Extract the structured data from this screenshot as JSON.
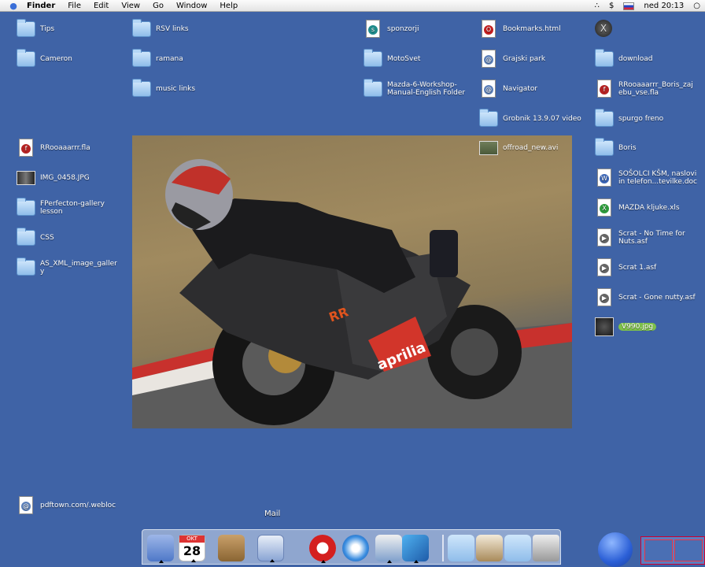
{
  "menubar": {
    "apple": "",
    "app_name": "Finder",
    "items": [
      "File",
      "Edit",
      "View",
      "Go",
      "Window",
      "Help"
    ],
    "clock": "ned 20:13"
  },
  "desktop_icons": [
    {
      "label": "Tips",
      "type": "folder"
    },
    {
      "label": "Cameron",
      "type": "folder"
    },
    {
      "label": "RSV links",
      "type": "folder"
    },
    {
      "label": "ramana",
      "type": "folder"
    },
    {
      "label": "music links",
      "type": "folder"
    },
    {
      "label": "sponzorji",
      "type": "doc"
    },
    {
      "label": "MotoSvet",
      "type": "folder"
    },
    {
      "label": "Mazda-6-Workshop-\nManual-English Folder",
      "type": "folder"
    },
    {
      "label": "Bookmarks.html",
      "type": "doc"
    },
    {
      "label": "Grajski park",
      "type": "doc"
    },
    {
      "label": "Navigator",
      "type": "doc"
    },
    {
      "label": "Grobnik 13.9.07 video",
      "type": "folder"
    },
    {
      "label": "offroad_new.avi",
      "type": "thumb"
    },
    {
      "label": "download",
      "type": "folder"
    },
    {
      "label": "RRooaaarrr_Boris_zaj\nebu_vse.fla",
      "type": "doc"
    },
    {
      "label": "spurgo freno",
      "type": "folder"
    },
    {
      "label": "Boris",
      "type": "folder"
    },
    {
      "label": "SOŠOLCI KŠM, naslovi\nin telefon...tevilke.doc",
      "type": "doc"
    },
    {
      "label": "MAZDA kljuke.xls",
      "type": "doc"
    },
    {
      "label": "Scrat - No Time for\nNuts.asf",
      "type": "doc"
    },
    {
      "label": "Scrat 1.asf",
      "type": "doc"
    },
    {
      "label": "Scrat - Gone nutty.asf",
      "type": "doc"
    },
    {
      "label": "V990.jpg",
      "type": "thumb"
    },
    {
      "label": "RRooaaarrr.fla",
      "type": "doc"
    },
    {
      "label": "IMG_0458.JPG",
      "type": "thumb"
    },
    {
      "label": "FPerfecton-gallery\nlesson",
      "type": "folder"
    },
    {
      "label": "CSS",
      "type": "folder"
    },
    {
      "label": "AS_XML_image_galler\ny",
      "type": "folder"
    },
    {
      "label": "pdftown.com/.webloc",
      "type": "doc"
    }
  ],
  "photo": {
    "alt": "Aprilia RR motorcycle leaning into a corner"
  },
  "photo_text": {
    "fairing": "aprilia",
    "tank": "RR"
  },
  "dock": {
    "label": "Mail",
    "calendar_month": "OKT",
    "calendar_day": "28"
  }
}
